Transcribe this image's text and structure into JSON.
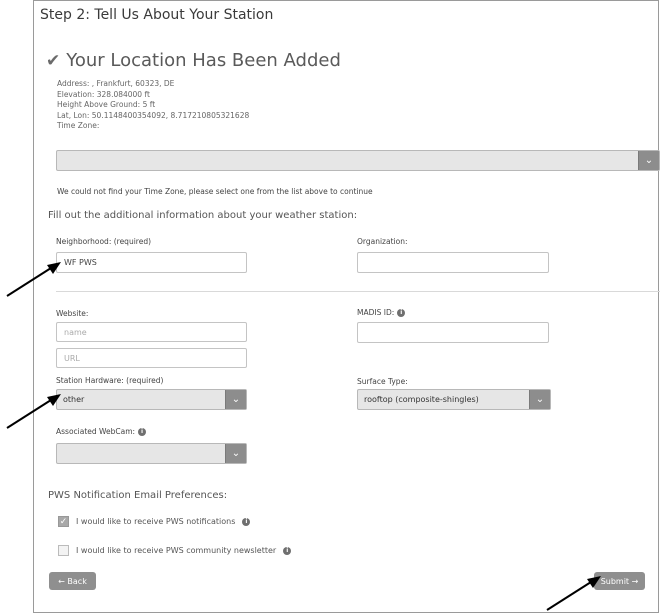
{
  "page": {
    "step_title": "Step 2: Tell Us About Your Station",
    "location_added_title": "Your Location Has Been Added",
    "check_icon": "✔"
  },
  "location": {
    "address": "Address:  , Frankfurt, 60323, DE",
    "elevation": "Elevation:  328.084000  ft",
    "height_above_ground": "Height Above Ground:  5  ft",
    "lat_lon": "Lat, Lon:  50.1148400354092, 8.717210805321628",
    "time_zone_label": "Time Zone:"
  },
  "time_zone": {
    "selected": "",
    "error_message": "We could not find your Time Zone, please select one from the list above to continue"
  },
  "form": {
    "intro": "Fill out the additional information about your weather station:",
    "neighborhood_label": "Neighborhood: (required)",
    "neighborhood_value": "WF PWS",
    "organization_label": "Organization:",
    "organization_value": "",
    "website_label": "Website:",
    "website_name_placeholder": "name",
    "website_url_placeholder": "URL",
    "madis_label": "MADIS ID:",
    "madis_value": "",
    "station_hardware_label": "Station Hardware: (required)",
    "station_hardware_value": "other",
    "surface_type_label": "Surface Type:",
    "surface_type_value": "rooftop (composite-shingles)",
    "webcam_label": "Associated WebCam:",
    "webcam_value": ""
  },
  "notifications": {
    "title": "PWS Notification Email Preferences:",
    "option1": "I would like to receive PWS notifications",
    "option1_checked": true,
    "option2": "I would like to receive PWS community newsletter",
    "option2_checked": false
  },
  "buttons": {
    "back": "← Back",
    "submit": "Submit →"
  },
  "icons": {
    "info": "info-icon",
    "chevron": "chevron-down-icon",
    "check": "check-icon",
    "arrow": "arrow-annotation-icon"
  }
}
